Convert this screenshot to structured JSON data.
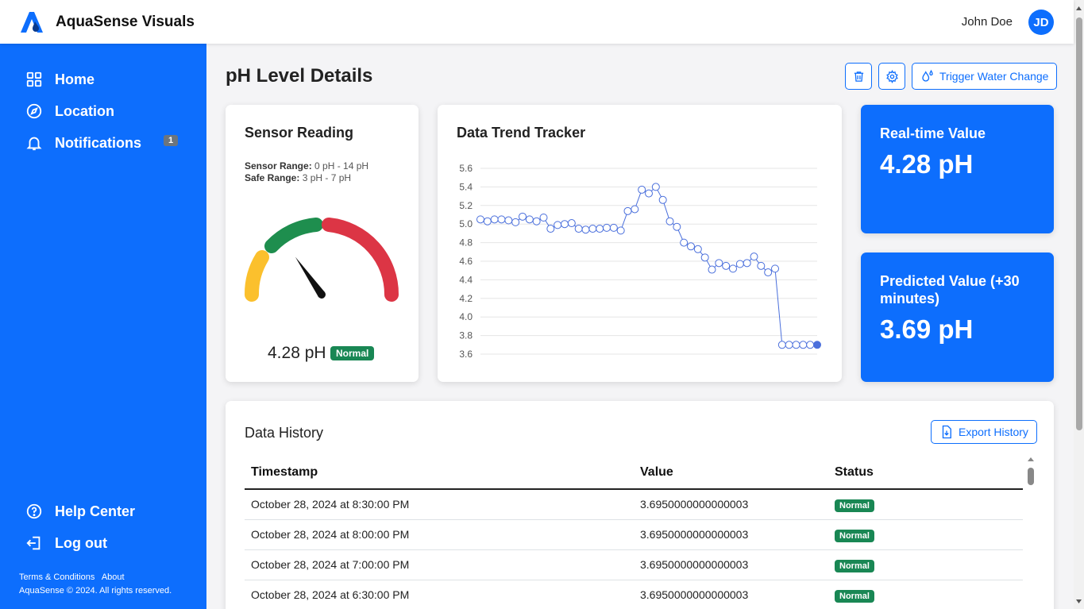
{
  "app": {
    "name": "AquaSense Visuals"
  },
  "user": {
    "name": "John Doe",
    "initials": "JD"
  },
  "sidebar": {
    "items": [
      {
        "label": "Home",
        "icon": "grid-icon"
      },
      {
        "label": "Location",
        "icon": "compass-icon"
      },
      {
        "label": "Notifications",
        "icon": "bell-icon",
        "badge": "1"
      }
    ],
    "bottom_items": [
      {
        "label": "Help Center",
        "icon": "help-circle-icon"
      },
      {
        "label": "Log out",
        "icon": "logout-icon"
      }
    ],
    "footer": {
      "terms": "Terms & Conditions",
      "about": "About",
      "copyright": "AquaSense © 2024. All rights reserved."
    }
  },
  "page": {
    "title": "pH Level Details",
    "actions": {
      "trigger_label": "Trigger Water Change",
      "delete_icon": "trash-icon",
      "settings_icon": "gear-icon",
      "trigger_icon": "water-drops-icon"
    }
  },
  "sensor": {
    "title": "Sensor Reading",
    "range_label": "Sensor Range:",
    "range_value": "0 pH - 14 pH",
    "safe_label": "Safe Range:",
    "safe_value": "3 pH - 7 pH",
    "value_text": "4.28 pH",
    "status": "Normal",
    "gauge_fraction": 0.306,
    "gauge_colors": {
      "low": "#fbc02d",
      "safe": "#1e8e4e",
      "high": "#dc3545"
    }
  },
  "trend": {
    "title": "Data Trend Tracker",
    "chart_data": {
      "type": "line",
      "ylim": [
        3.6,
        5.6
      ],
      "yticks": [
        "5.6",
        "5.4",
        "5.2",
        "5.0",
        "4.8",
        "4.6",
        "4.4",
        "4.2",
        "4.0",
        "3.8",
        "3.6"
      ],
      "values": [
        5.05,
        5.03,
        5.05,
        5.05,
        5.04,
        5.02,
        5.08,
        5.05,
        5.03,
        5.07,
        4.95,
        4.99,
        5.0,
        5.01,
        4.95,
        4.94,
        4.95,
        4.95,
        4.96,
        4.96,
        4.93,
        5.14,
        5.16,
        5.37,
        5.33,
        5.4,
        5.26,
        5.03,
        4.97,
        4.8,
        4.76,
        4.73,
        4.64,
        4.51,
        4.58,
        4.55,
        4.52,
        4.57,
        4.58,
        4.65,
        4.55,
        4.48,
        4.52,
        3.7,
        3.7,
        3.7,
        3.7,
        3.7,
        3.7
      ],
      "color": "#4a6fdc"
    }
  },
  "realtime": {
    "label": "Real-time Value",
    "value": "4.28 pH"
  },
  "predicted": {
    "label": "Predicted Value (+30 minutes)",
    "value": "3.69 pH"
  },
  "history": {
    "title": "Data History",
    "export_label": "Export History",
    "columns": [
      "Timestamp",
      "Value",
      "Status"
    ],
    "rows": [
      {
        "timestamp": "October 28, 2024 at 8:30:00 PM",
        "value": "3.6950000000000003",
        "status": "Normal"
      },
      {
        "timestamp": "October 28, 2024 at 8:00:00 PM",
        "value": "3.6950000000000003",
        "status": "Normal"
      },
      {
        "timestamp": "October 28, 2024 at 7:00:00 PM",
        "value": "3.6950000000000003",
        "status": "Normal"
      },
      {
        "timestamp": "October 28, 2024 at 6:30:00 PM",
        "value": "3.6950000000000003",
        "status": "Normal"
      }
    ]
  }
}
